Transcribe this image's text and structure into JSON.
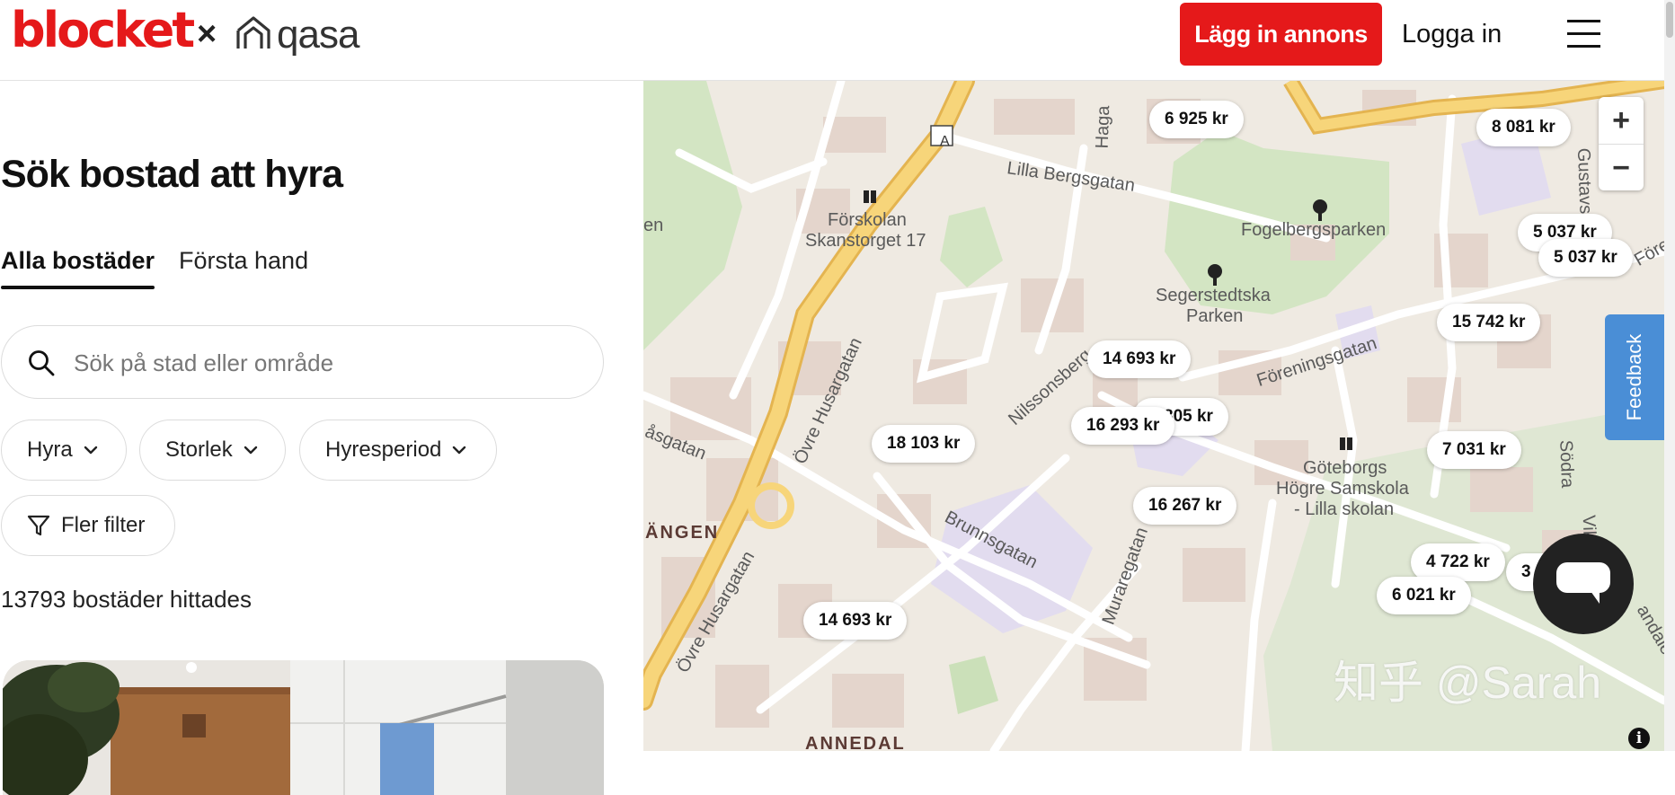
{
  "header": {
    "logo_primary": "blocket",
    "logo_separator": "×",
    "logo_partner": "qasa",
    "post_ad_label": "Lägg in annons",
    "login_label": "Logga in"
  },
  "search_page": {
    "title": "Sök bostad att hyra",
    "tabs": [
      {
        "label": "Alla bostäder",
        "active": true
      },
      {
        "label": "Första hand",
        "active": false
      }
    ],
    "search_placeholder": "Sök på stad eller område",
    "filters": [
      {
        "label": "Hyra"
      },
      {
        "label": "Storlek"
      },
      {
        "label": "Hyresperiod"
      },
      {
        "label": "Fler filter"
      }
    ],
    "results_count_text": "13793 bostäder hittades"
  },
  "map": {
    "zoom_in": "+",
    "zoom_out": "−",
    "feedback_label": "Feedback",
    "info_label": "i",
    "street_labels": {
      "lilla_bergsgatan": "Lilla Bergsgatan",
      "forskolan": "Förskolan",
      "skanstorget": "Skanstorget 17",
      "fogelbergsparken": "Fogelbergsparken",
      "segerstedtska": "Segerstedtska",
      "parken": "Parken",
      "foreningsgatan": "Föreningsgatan",
      "nilssonsberg": "Nilssonsberg",
      "ovre_husargatan_1": "Övre Husargatan",
      "ovre_husargatan_2": "Övre Husargatan",
      "brunnsgatan": "Brunnsgatan",
      "muraregatan": "Muraregatan",
      "goteborgs": "Göteborgs",
      "hogre_samskola": "Högre Samskola",
      "lilla_skolan": "- Lilla skolan",
      "angen": "ÄNGEN",
      "annedal": "ANNEDAL",
      "asgatan": "åsgatan",
      "en": "en",
      "hag": "Haga",
      "gustavs": "Gustavs",
      "sodra": "Södra",
      "ktoriagatan": "Viktoriagatan",
      "fore": "Före",
      "sandale": "andale",
      "route_a": "A"
    },
    "price_markers": [
      {
        "label": "6 925 kr"
      },
      {
        "label": "8 081 kr"
      },
      {
        "label": "5 037 kr"
      },
      {
        "label": "5 037 kr"
      },
      {
        "label": "15 742 kr"
      },
      {
        "label": "14 693 kr"
      },
      {
        "label": "805 kr"
      },
      {
        "label": "16 293 kr"
      },
      {
        "label": "18 103 kr"
      },
      {
        "label": "7 031 kr"
      },
      {
        "label": "16 267 kr"
      },
      {
        "label": "4 722 kr"
      },
      {
        "label": "3 605 kr"
      },
      {
        "label": "6 021 kr"
      },
      {
        "label": "14 693 kr"
      }
    ]
  },
  "watermark": "知乎 @Sarah",
  "colors": {
    "brand_red": "#e5191a",
    "feedback_blue": "#4a8ed6",
    "map_background": "#efeae2",
    "park_green": "#d3e5c3",
    "major_road_yellow": "#f7d57a"
  }
}
